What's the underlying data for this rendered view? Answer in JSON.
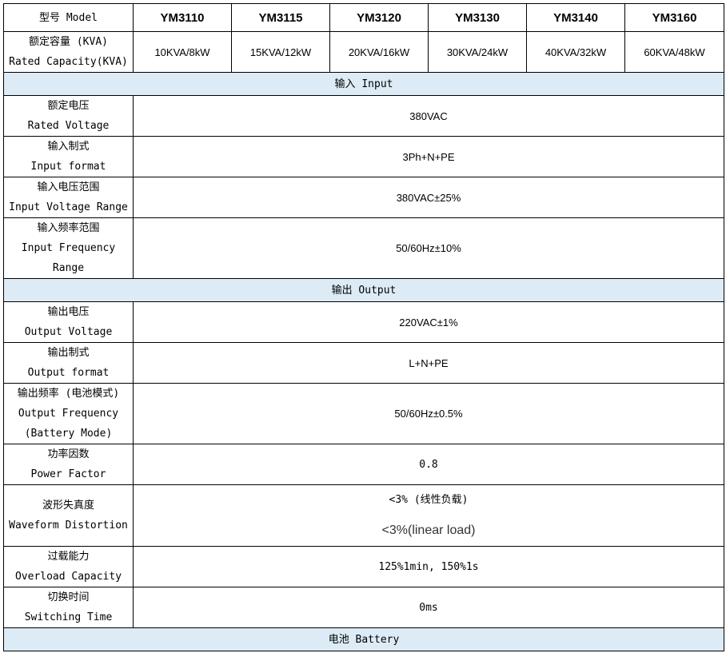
{
  "header": {
    "model_label": "型号 Model",
    "models": [
      "YM3110",
      "YM3115",
      "YM3120",
      "YM3130",
      "YM3140",
      "YM3160"
    ]
  },
  "capacity": {
    "label_cn": "额定容量 (KVA)",
    "label_en": "Rated Capacity(KVA)",
    "values": [
      "10KVA/8kW",
      "15KVA/12kW",
      "20KVA/16kW",
      "30KVA/24kW",
      "40KVA/32kW",
      "60KVA/48kW"
    ]
  },
  "input": {
    "section_title": "输入 Input",
    "rows": [
      {
        "label": [
          "额定电压",
          "Rated Voltage"
        ],
        "value": "380VAC"
      },
      {
        "label": [
          "输入制式",
          "Input format"
        ],
        "value": "3Ph+N+PE"
      },
      {
        "label": [
          "输入电压范围",
          "Input Voltage Range"
        ],
        "value": "380VAC±25%"
      },
      {
        "label": [
          "输入频率范围",
          "Input Frequency",
          "Range"
        ],
        "value": "50/60Hz±10%"
      }
    ]
  },
  "output": {
    "section_title": "输出 Output",
    "rows": [
      {
        "label": [
          "输出电压",
          "Output Voltage"
        ],
        "value": "220VAC±1%"
      },
      {
        "label": [
          "输出制式",
          "Output format"
        ],
        "value": "L+N+PE"
      },
      {
        "label": [
          "输出频率 (电池模式)",
          "Output Frequency",
          "(Battery Mode)"
        ],
        "value": "50/60Hz±0.5%"
      },
      {
        "label": [
          "功率因数",
          "Power Factor"
        ],
        "value": "0.8"
      },
      {
        "label": [
          "波形失真度",
          "Waveform Distortion"
        ],
        "value_lines": [
          "<3% (线性负载)",
          "<3%(linear load)"
        ]
      },
      {
        "label": [
          "过载能力",
          "Overload Capacity"
        ],
        "value": "125%1min, 150%1s"
      },
      {
        "label": [
          "切换时间",
          "Switching Time"
        ],
        "value": "0ms"
      }
    ]
  },
  "battery": {
    "section_title": "电池 Battery"
  }
}
